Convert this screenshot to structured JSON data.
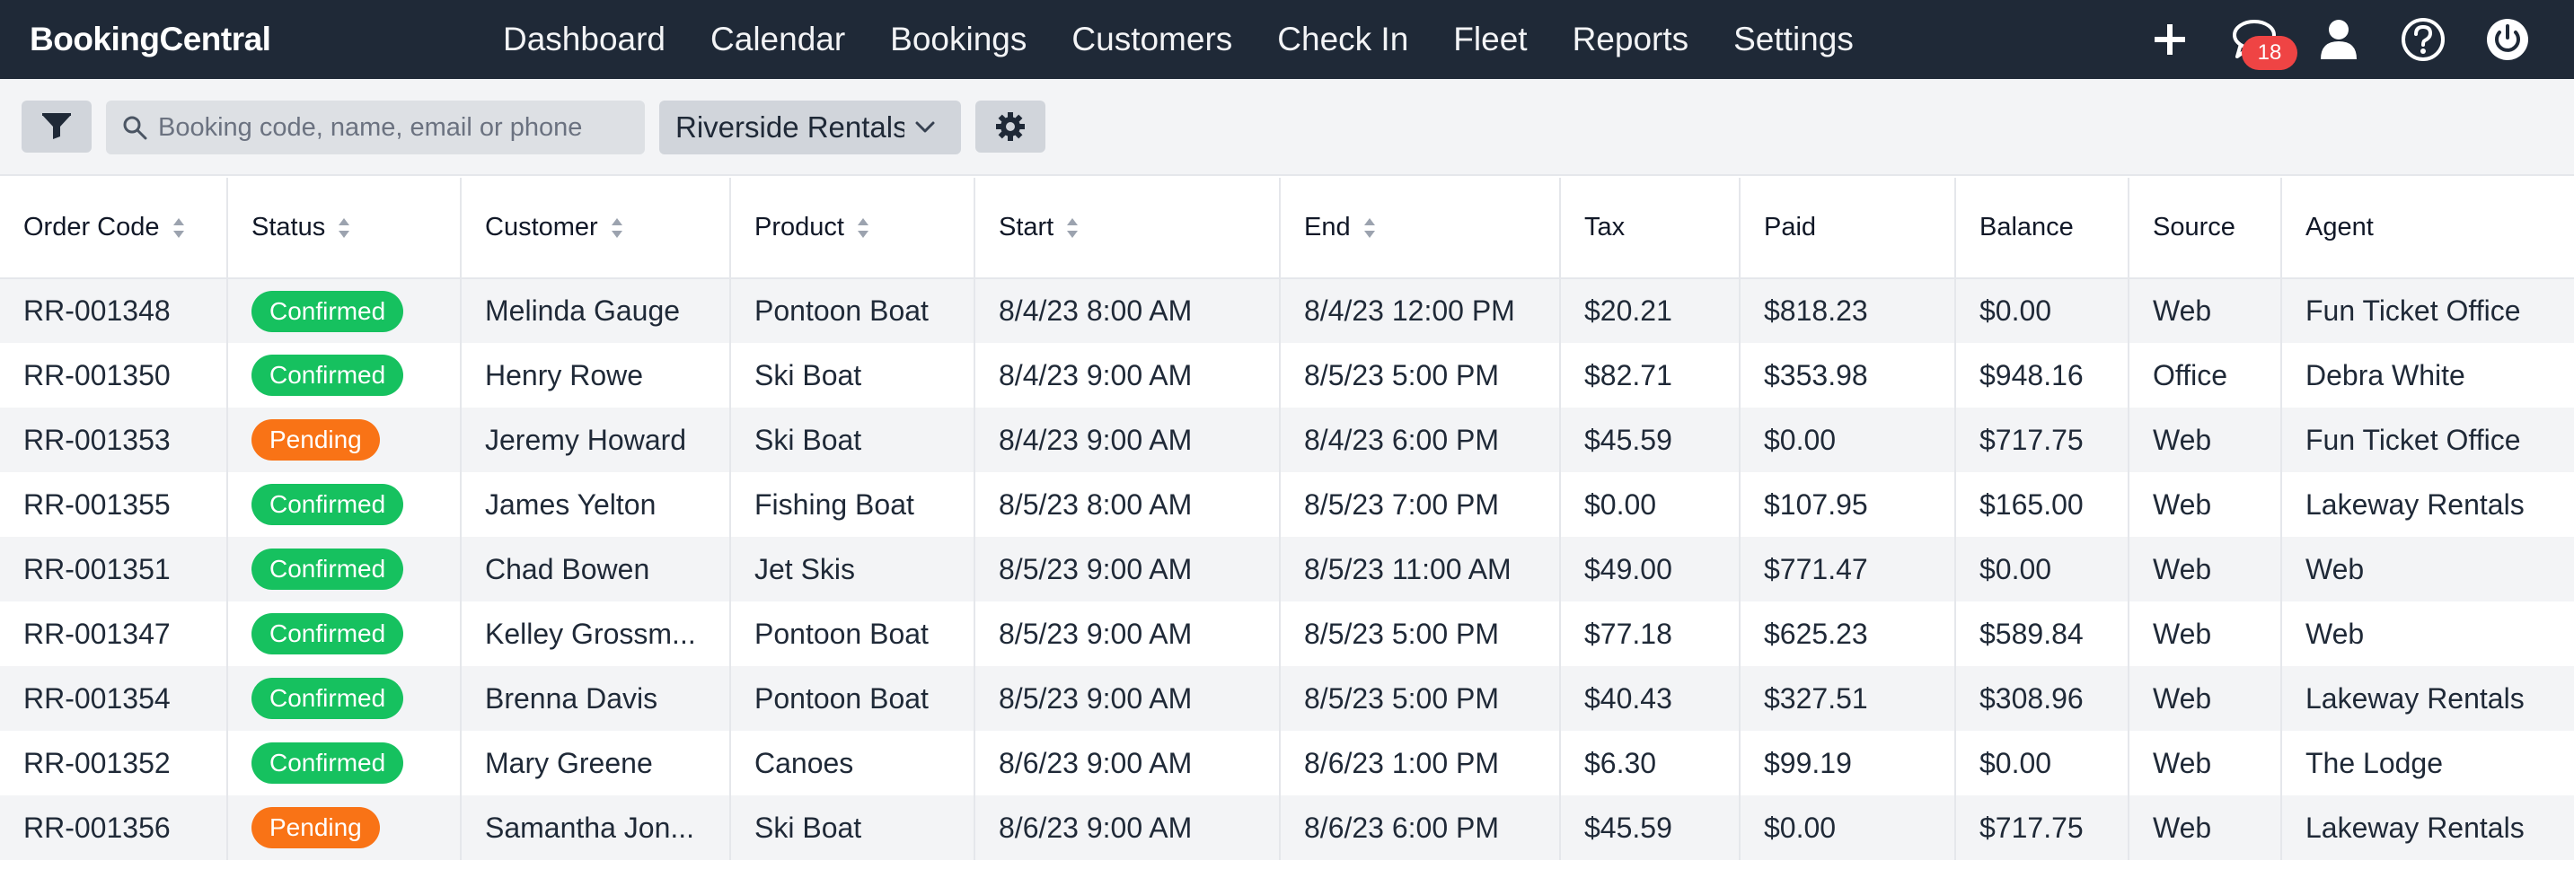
{
  "app": {
    "brand": "BookingCentral"
  },
  "nav": [
    {
      "label": "Dashboard"
    },
    {
      "label": "Calendar"
    },
    {
      "label": "Bookings"
    },
    {
      "label": "Customers"
    },
    {
      "label": "Check In"
    },
    {
      "label": "Fleet"
    },
    {
      "label": "Reports"
    },
    {
      "label": "Settings"
    }
  ],
  "header_icons": {
    "add": "plus-icon",
    "messages": "chat-icon",
    "messages_count": "18",
    "profile": "user-icon",
    "help": "help-icon",
    "logout": "power-icon"
  },
  "toolbar": {
    "filter_icon": "filter-icon",
    "search_placeholder": "Booking code, name, email or phone",
    "location_selected": "Riverside Rentals",
    "settings_icon": "gear-icon"
  },
  "table": {
    "columns": [
      "Order Code",
      "Status",
      "Customer",
      "Product",
      "Start",
      "End",
      "Tax",
      "Paid",
      "Balance",
      "Source",
      "Agent"
    ],
    "rows": [
      {
        "code": "RR-001348",
        "status": "Confirmed",
        "customer": "Melinda Gauge",
        "product": "Pontoon Boat",
        "start": "8/4/23 8:00 AM",
        "end": "8/4/23 12:00 PM",
        "tax": "$20.21",
        "paid": "$818.23",
        "balance": "$0.00",
        "source": "Web",
        "agent": "Fun Ticket Office"
      },
      {
        "code": "RR-001350",
        "status": "Confirmed",
        "customer": "Henry Rowe",
        "product": "Ski Boat",
        "start": "8/4/23 9:00 AM",
        "end": "8/5/23 5:00 PM",
        "tax": "$82.71",
        "paid": "$353.98",
        "balance": "$948.16",
        "source": "Office",
        "agent": "Debra White"
      },
      {
        "code": "RR-001353",
        "status": "Pending",
        "customer": "Jeremy Howard",
        "product": "Ski Boat",
        "start": "8/4/23 9:00 AM",
        "end": "8/4/23 6:00 PM",
        "tax": "$45.59",
        "paid": "$0.00",
        "balance": "$717.75",
        "source": "Web",
        "agent": "Fun Ticket Office"
      },
      {
        "code": "RR-001355",
        "status": "Confirmed",
        "customer": "James Yelton",
        "product": "Fishing Boat",
        "start": "8/5/23 8:00 AM",
        "end": "8/5/23 7:00 PM",
        "tax": "$0.00",
        "paid": "$107.95",
        "balance": "$165.00",
        "source": "Web",
        "agent": "Lakeway Rentals"
      },
      {
        "code": "RR-001351",
        "status": "Confirmed",
        "customer": "Chad Bowen",
        "product": "Jet Skis",
        "start": "8/5/23 9:00 AM",
        "end": "8/5/23 11:00 AM",
        "tax": "$49.00",
        "paid": "$771.47",
        "balance": "$0.00",
        "source": "Web",
        "agent": "Web"
      },
      {
        "code": "RR-001347",
        "status": "Confirmed",
        "customer": "Kelley Grossm...",
        "product": "Pontoon Boat",
        "start": "8/5/23 9:00 AM",
        "end": "8/5/23 5:00 PM",
        "tax": "$77.18",
        "paid": "$625.23",
        "balance": "$589.84",
        "source": "Web",
        "agent": "Web"
      },
      {
        "code": "RR-001354",
        "status": "Confirmed",
        "customer": "Brenna Davis",
        "product": "Pontoon Boat",
        "start": "8/5/23 9:00 AM",
        "end": "8/5/23 5:00 PM",
        "tax": "$40.43",
        "paid": "$327.51",
        "balance": "$308.96",
        "source": "Web",
        "agent": "Lakeway Rentals"
      },
      {
        "code": "RR-001352",
        "status": "Confirmed",
        "customer": "Mary Greene",
        "product": "Canoes",
        "start": "8/6/23 9:00 AM",
        "end": "8/6/23 1:00 PM",
        "tax": "$6.30",
        "paid": "$99.19",
        "balance": "$0.00",
        "source": "Web",
        "agent": "The Lodge"
      },
      {
        "code": "RR-001356",
        "status": "Pending",
        "customer": "Samantha Jon...",
        "product": "Ski Boat",
        "start": "8/6/23 9:00 AM",
        "end": "8/6/23 6:00 PM",
        "tax": "$45.59",
        "paid": "$0.00",
        "balance": "$717.75",
        "source": "Web",
        "agent": "Lakeway Rentals"
      }
    ]
  },
  "colors": {
    "nav_bg": "#1f2937",
    "confirmed": "#16c15f",
    "pending": "#f97316",
    "badge": "#ef4444"
  }
}
